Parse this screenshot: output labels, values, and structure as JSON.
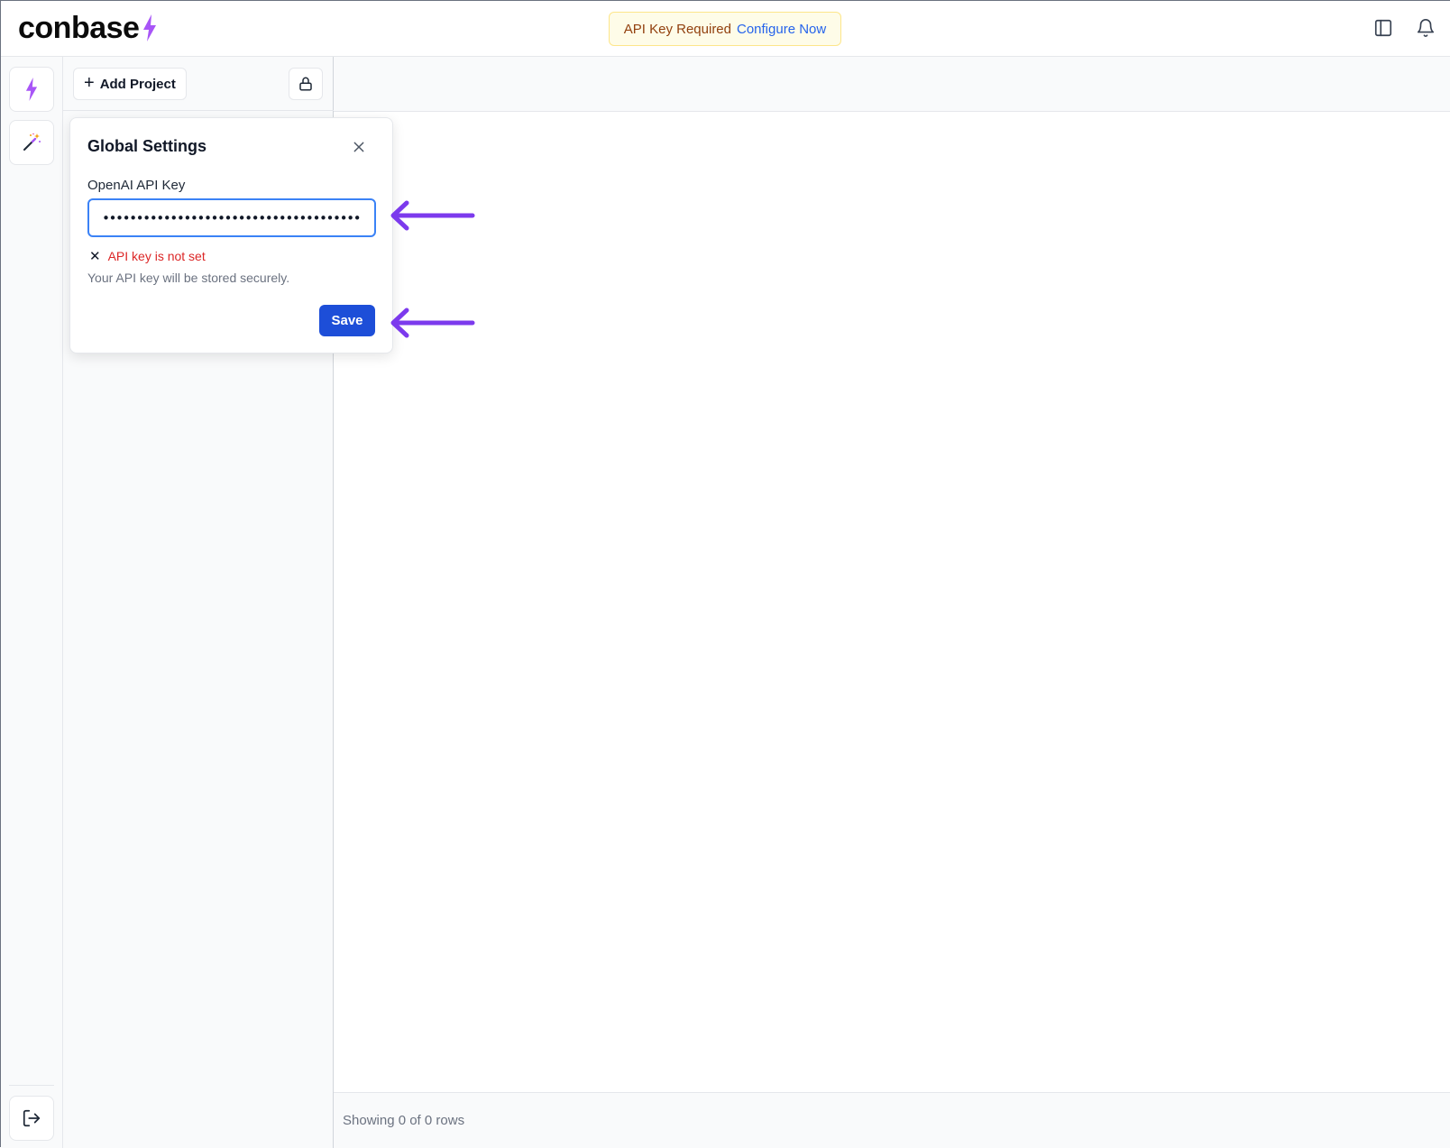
{
  "brand": {
    "name": "conbase",
    "bolt_color": "#a855f7"
  },
  "header": {
    "banner_text": "API Key Required",
    "banner_link": "Configure Now",
    "icons": [
      "sidebar-toggle-icon",
      "bell-icon"
    ]
  },
  "rail": {
    "items": [
      {
        "icon": "lightning-bolt-icon"
      },
      {
        "icon": "magic-wand-icon"
      }
    ],
    "bottom_icon": "logout-icon"
  },
  "projects": {
    "add_label": "Add Project",
    "lock_icon": "lock-icon"
  },
  "settings": {
    "title": "Global Settings",
    "api_key_label": "OpenAI API Key",
    "api_key_value": "••••••••••••••••••••••••••••••••••••••••••••••••",
    "error_text": "API key is not set",
    "help_text": "Your API key will be stored securely.",
    "save_label": "Save"
  },
  "footer": {
    "status": "Showing 0 of 0 rows"
  },
  "colors": {
    "accent": "#1d4ed8",
    "annotation_arrow": "#7c3aed",
    "error": "#dc2626",
    "banner_bg": "#fefce8"
  }
}
